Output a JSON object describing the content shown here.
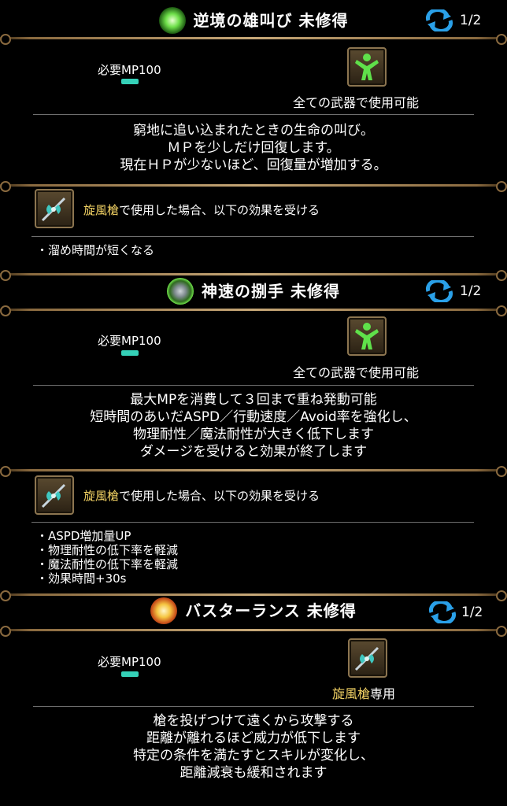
{
  "skills": [
    {
      "title": "逆境の雄叫び 未修得",
      "page": "1/2",
      "mp": "必要MP100",
      "usable": "全ての武器で使用可能",
      "description": "窮地に追い込まれたときの生命の叫び。\nＭＰを少しだけ回復します。\n現在ＨＰが少ないほど、回復量が増加する。",
      "weapon_name": "旋風槍",
      "effect_suffix": "で使用した場合、以下の効果を受ける",
      "bullets": [
        "・溜め時間が短くなる"
      ]
    },
    {
      "title": "神速の捌手 未修得",
      "page": "1/2",
      "mp": "必要MP100",
      "usable": "全ての武器で使用可能",
      "description": "最大MPを消費して３回まで重ね発動可能\n短時間のあいだASPD／行動速度／Avoid率を強化し、\n物理耐性／魔法耐性が大きく低下します\nダメージを受けると効果が終了します",
      "weapon_name": "旋風槍",
      "effect_suffix": "で使用した場合、以下の効果を受ける",
      "bullets": [
        "・ASPD増加量UP",
        "・物理耐性の低下率を軽減",
        "・魔法耐性の低下率を軽減",
        "・効果時間+30s"
      ]
    },
    {
      "title": "バスターランス 未修得",
      "page": "1/2",
      "mp": "必要MP100",
      "weapon_name": "旋風槍",
      "weapon_only_suffix": "専用",
      "description": "槍を投げつけて遠くから攻撃する\n距離が離れるほど威力が低下します\n特定の条件を満たすとスキルが変化し、\n距離減衰も緩和されます"
    }
  ],
  "icons": {
    "skill1": "green-burst-icon",
    "skill2": "shield-icon",
    "skill3": "spear-strike-icon",
    "all_weapons": "green-person-icon",
    "halberd": "halberd-icon",
    "cycle": "cycle-arrows-icon"
  },
  "colors": {
    "accent_gold": "#f2d264",
    "mp_bar": "#35d1b8",
    "frame_gold": "#c7a878"
  }
}
